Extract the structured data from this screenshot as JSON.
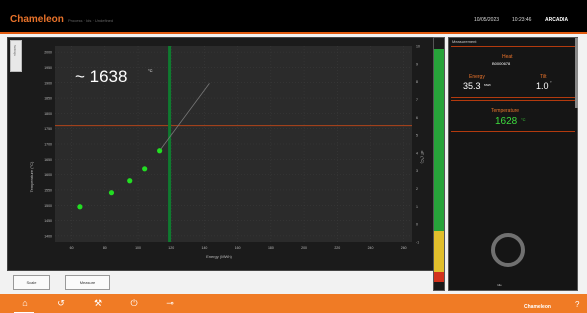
{
  "header": {
    "app_title": "Chameleon",
    "breadcrumb": "Process · Ids · Undefined",
    "date": "10/05/2023",
    "time": "10:23:46",
    "user": "ARCADIA"
  },
  "chart_data": {
    "type": "scatter",
    "title": "",
    "xlabel": "Energy (MWh)",
    "ylabel": "Temperature (°C)",
    "y2label": "dT (°C)",
    "x_ticks": [
      "60",
      "80",
      "100",
      "120",
      "140",
      "160",
      "180",
      "200",
      "220",
      "240",
      "260"
    ],
    "y_ticks": [
      "1400",
      "1450",
      "1500",
      "1550",
      "1600",
      "1650",
      "1700",
      "1750",
      "1800",
      "1850",
      "1900",
      "1950",
      "2000"
    ],
    "y2_ticks": [
      "10",
      "9",
      "8",
      "7",
      "6",
      "5",
      "4",
      "3",
      "2",
      "1",
      "0",
      "-1"
    ],
    "xlim": [
      50,
      265
    ],
    "ylim": [
      1380,
      2020
    ],
    "series": [
      {
        "points": [
          [
            65,
            1495
          ],
          [
            84,
            1541
          ],
          [
            95,
            1580
          ],
          [
            104,
            1619
          ],
          [
            113,
            1678
          ]
        ]
      }
    ],
    "target_temperature": 1760,
    "current_energy": 119,
    "annotation": "~ 1638",
    "annotation_unit": "°C"
  },
  "right_panel": {
    "title": "Measurement",
    "heat_label": "Heat",
    "heat_value": "B0000678",
    "energy_label": "Energy",
    "energy_value": "35.3",
    "energy_unit": "MWh",
    "tilt_label": "Tilt",
    "tilt_value": "1.0",
    "tilt_unit": "°",
    "temp_label": "Temperature",
    "temp_value": "1628",
    "temp_unit": "°C",
    "gauge_label": "Idle"
  },
  "level_bar": {
    "green_fraction": 0.76,
    "yellow_fraction": 0.17,
    "red_fraction": 0.04
  },
  "buttons": {
    "left": "Scale",
    "right": "Measure"
  },
  "footer": {
    "brand": "Chameleon"
  },
  "colors": {
    "accent": "#f07b25",
    "plot_bg": "#2b2b2b",
    "point": "#22dd22",
    "target_line": "#b2451a",
    "cursor_line": "#0f7a2f"
  }
}
